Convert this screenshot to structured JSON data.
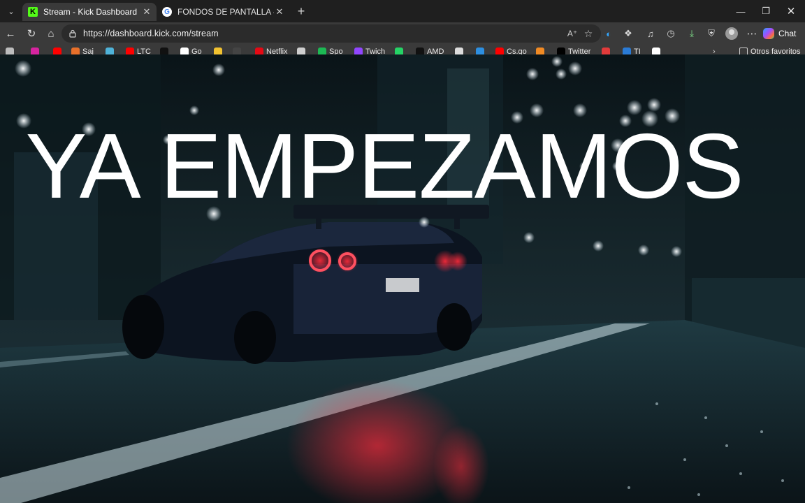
{
  "browser": {
    "tabs": [
      {
        "title": "Stream - Kick Dashboard",
        "favicon": "kick-logo-icon",
        "active": true
      },
      {
        "title": "FONDOS DE PANTALLA - Buscar c",
        "favicon": "google-logo-icon",
        "active": false
      }
    ],
    "address": {
      "url": "https://dashboard.kick.com/stream"
    },
    "chat_label": "Chat",
    "favorites": [
      {
        "label": "",
        "icon": "instagram-icon",
        "color": "#d6249f"
      },
      {
        "label": "",
        "icon": "youtube-icon",
        "color": "#ff0000"
      },
      {
        "label": "Saj",
        "icon": "generic-site-icon",
        "color": "#e8702a"
      },
      {
        "label": "",
        "icon": "generic-site-icon",
        "color": "#4fb3d9"
      },
      {
        "label": "LTC",
        "icon": "youtube-icon",
        "color": "#ff0000"
      },
      {
        "label": "",
        "icon": "tiktok-icon",
        "color": "#111111"
      },
      {
        "label": "Go",
        "icon": "google-logo-icon",
        "color": "#ffffff"
      },
      {
        "label": "",
        "icon": "generic-site-icon",
        "color": "#f2c230"
      },
      {
        "label": "",
        "icon": "generic-site-icon",
        "color": "#444444"
      },
      {
        "label": "Netflix",
        "icon": "netflix-icon",
        "color": "#e50914"
      },
      {
        "label": "",
        "icon": "generic-site-icon",
        "color": "#cfcfcf"
      },
      {
        "label": "Spo",
        "icon": "spotify-icon",
        "color": "#1db954"
      },
      {
        "label": "Twich",
        "icon": "twitch-icon",
        "color": "#9146ff"
      },
      {
        "label": "",
        "icon": "whatsapp-icon",
        "color": "#25d366"
      },
      {
        "label": "AMD",
        "icon": "amd-icon",
        "color": "#111111"
      },
      {
        "label": "",
        "icon": "generic-site-icon",
        "color": "#dddddd"
      },
      {
        "label": "",
        "icon": "generic-site-icon",
        "color": "#2d8fe0"
      },
      {
        "label": "Cs.go",
        "icon": "youtube-icon",
        "color": "#ff0000"
      },
      {
        "label": "",
        "icon": "generic-site-icon",
        "color": "#f08a24"
      },
      {
        "label": "Twitter",
        "icon": "x-twitter-icon",
        "color": "#000000"
      },
      {
        "label": "",
        "icon": "generic-site-icon",
        "color": "#e23b3b"
      },
      {
        "label": "TI",
        "icon": "generic-site-icon",
        "color": "#2a7bd6"
      },
      {
        "label": "",
        "icon": "google-logo-icon",
        "color": "#ffffff"
      }
    ],
    "other_favorites": "Otros favoritos"
  },
  "stream": {
    "headline": "YA EMPEZAMOS",
    "background": "night-rain-street-sports-car"
  }
}
